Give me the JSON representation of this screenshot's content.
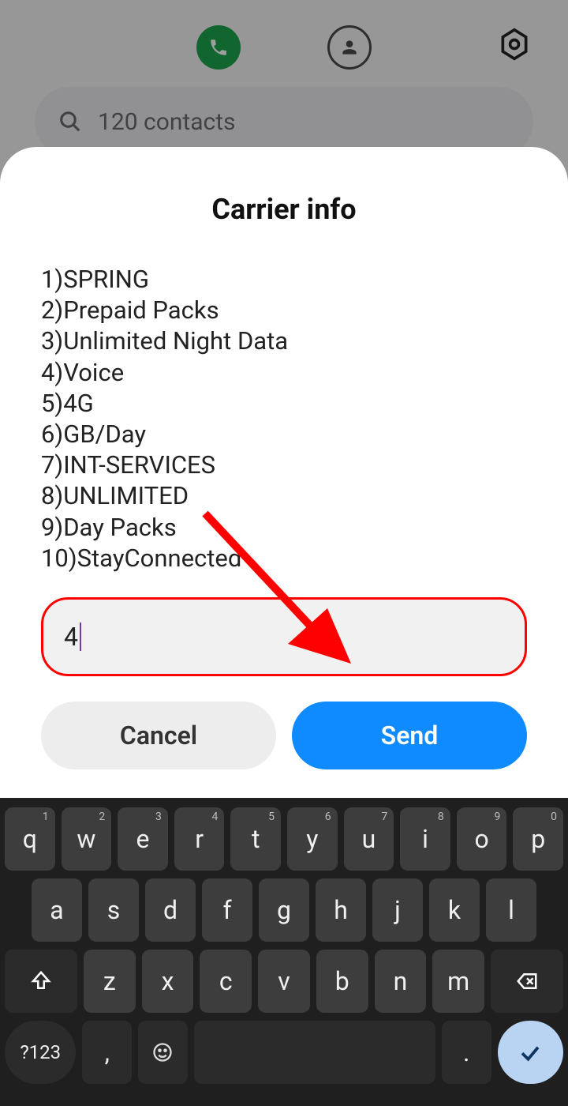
{
  "search": {
    "placeholder": "120 contacts"
  },
  "dialog": {
    "title": "Carrier info",
    "options": [
      "1)SPRING",
      "2)Prepaid Packs",
      "3)Unlimited Night Data",
      "4)Voice",
      "5)4G",
      "6)GB/Day",
      "7)INT-SERVICES",
      "8)UNLIMITED",
      "9)Day Packs",
      "10)StayConnected"
    ],
    "input_value": "4",
    "cancel_label": "Cancel",
    "send_label": "Send"
  },
  "keyboard": {
    "row1": [
      {
        "k": "q",
        "n": "1"
      },
      {
        "k": "w",
        "n": "2"
      },
      {
        "k": "e",
        "n": "3"
      },
      {
        "k": "r",
        "n": "4"
      },
      {
        "k": "t",
        "n": "5"
      },
      {
        "k": "y",
        "n": "6"
      },
      {
        "k": "u",
        "n": "7"
      },
      {
        "k": "i",
        "n": "8"
      },
      {
        "k": "o",
        "n": "9"
      },
      {
        "k": "p",
        "n": "0"
      }
    ],
    "row2": [
      "a",
      "s",
      "d",
      "f",
      "g",
      "h",
      "j",
      "k",
      "l"
    ],
    "row3": [
      "z",
      "x",
      "c",
      "v",
      "b",
      "n",
      "m"
    ],
    "symbols_label": "?123",
    "comma": ",",
    "period": "."
  }
}
